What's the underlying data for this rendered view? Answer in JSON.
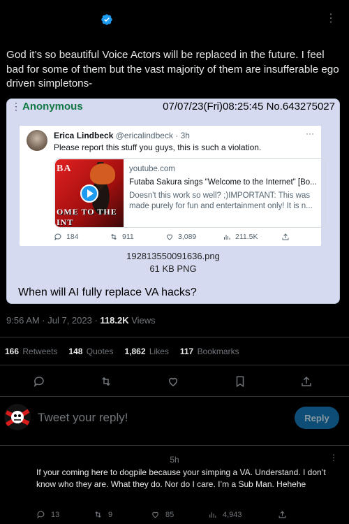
{
  "header": {
    "verified_icon": "verified-badge-icon",
    "more_label": "⋮"
  },
  "tweet": {
    "text": "God it’s so beautiful Voice Actors will be replaced in the future. I feel bad for some of them but the vast majority of them are insufferable ego driven simpletons-"
  },
  "post_card": {
    "menu_glyph": "⋮",
    "name": "Anonymous",
    "meta": "07/07/23(Fri)08:25:45 No.643275027",
    "embedded_tweet": {
      "display_name": "Erica Lindbeck",
      "handle": "@ericalindbeck · 3h",
      "more": "···",
      "text": "Please report this stuff you guys, this is such a violation.",
      "link_card": {
        "thumb_text_top": "BA",
        "thumb_text_bottom": "OME TO THE INT",
        "domain": "youtube.com",
        "title": "Futaba Sakura sings \"Welcome to the Internet\" [Bo...",
        "description": "Doesn't this work so well? ;)IMPORTANT: This was made purely for fun and entertainment only! It is n..."
      },
      "actions": {
        "replies": "184",
        "retweets": "911",
        "likes": "3,089",
        "views": "211.5K"
      }
    },
    "filename": "192813550091636.png",
    "filesize": "61 KB PNG",
    "caption": "When will AI fully replace VA hacks?"
  },
  "meta": {
    "time": "9:56 AM · Jul 7, 2023 · ",
    "views_count": "118.2K",
    "views_label": " Views"
  },
  "stats": {
    "retweets_count": "166",
    "retweets_label": "Retweets",
    "quotes_count": "148",
    "quotes_label": "Quotes",
    "likes_count": "1,862",
    "likes_label": "Likes",
    "bookmarks_count": "117",
    "bookmarks_label": "Bookmarks"
  },
  "reply_box": {
    "placeholder": "Tweet your reply!",
    "button_label": "Reply"
  },
  "reply": {
    "time": "5h",
    "more": "⋮",
    "text": "If your coming here to dogpile because your simping a VA. Understand. I don’t know who they are. What they do. Nor do I care. I’m a Sub Man. Hehehe",
    "replies": "13",
    "retweets": "9",
    "likes": "85",
    "views": "4,943"
  },
  "colors": {
    "background": "#000000",
    "card_bg": "#d6daf0",
    "anon_green": "#117743",
    "accent_blue": "#1d9bf0",
    "reply_button": "#0e4d75",
    "muted": "#71767b"
  }
}
